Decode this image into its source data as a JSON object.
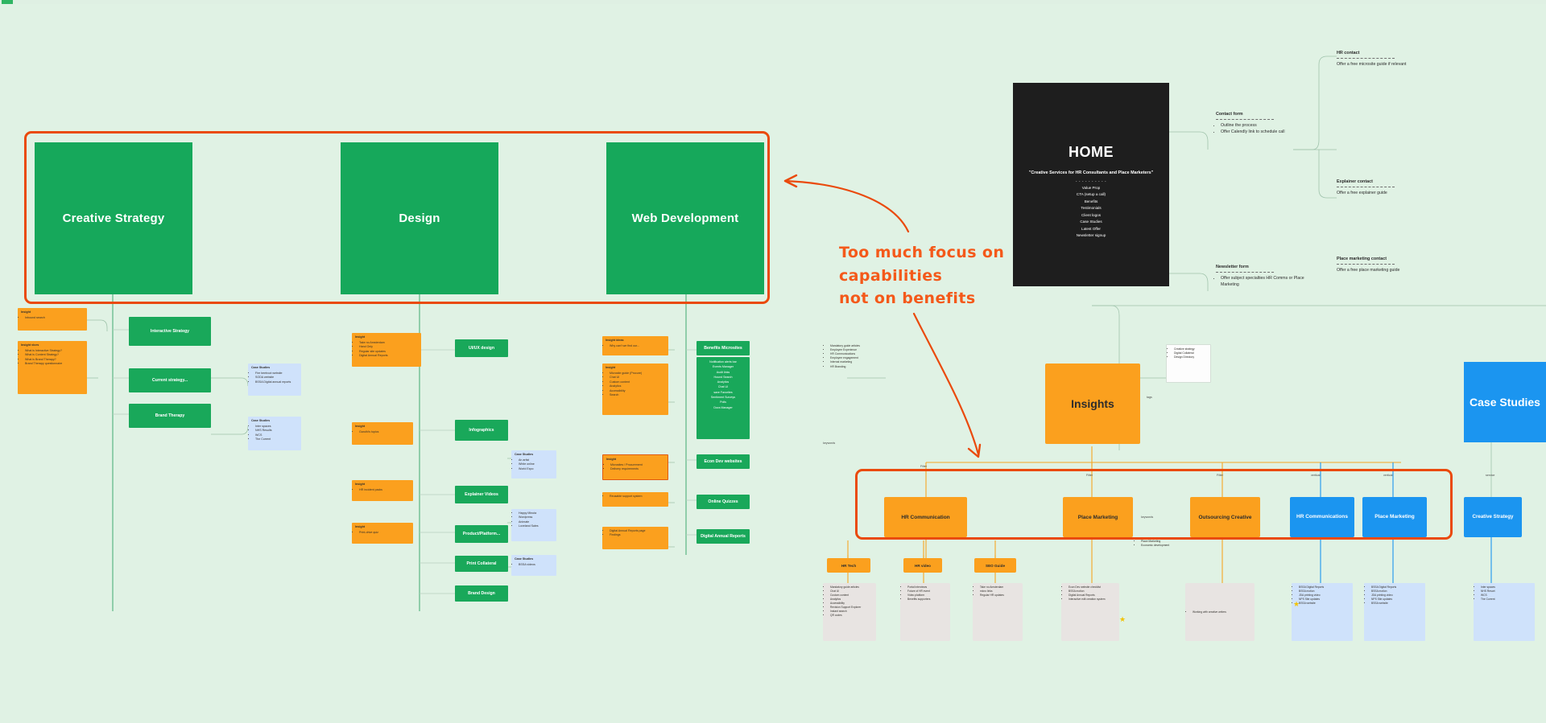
{
  "meta": {
    "title": "Website sitemap / user-flow whiteboard",
    "canvas_bg": "#e0f2e4",
    "accent_orange": "#ea4a0c",
    "green": "#19a85a",
    "amber": "#fba01e",
    "blue": "#1b95f0"
  },
  "annotation": {
    "text": "Too much focus on\ncapabilities\nnot on benefits",
    "color": "#f4591a"
  },
  "pillars": [
    {
      "label": "Creative Strategy"
    },
    {
      "label": "Design"
    },
    {
      "label": "Web Development"
    }
  ],
  "home": {
    "title": "HOME",
    "tagline": "\"Creative Services for HR Consultants and Place Marketers\"",
    "divider": "- - - - - - - - - -",
    "items": [
      "Value Prop",
      "CTA (setup a call)",
      "Benefits",
      "Testimonials",
      "Client logos",
      "Case Studies",
      "Latest Offer",
      "Newsletter signup"
    ]
  },
  "contact_flow": {
    "contact_form": {
      "title": "Contact form",
      "items": [
        "Outline the process",
        "Offer Calendly link to schedule call"
      ]
    },
    "newsletter_form": {
      "title": "Newsletter form",
      "items": [
        "Offer subject specialties HR Comms or Place Marketing"
      ]
    },
    "outcomes": [
      {
        "title": "HR contact",
        "body": "Offer a free microsite guide if relevant"
      },
      {
        "title": "Place marketing contact",
        "body": "Offer a free place marketing guide"
      },
      {
        "title": "Explainer contact",
        "body": "Offer a free explainer guide"
      }
    ]
  },
  "strategy_branch": {
    "nodes": [
      "Interactive Strategy",
      "Current strategy...",
      "Brand Therapy"
    ],
    "insights": [
      {
        "title": "Insight",
        "items": [
          "Inbound search"
        ]
      },
      {
        "title": "Insight vices",
        "items": [
          "What is Interactive Strategy?",
          "What is Content Strategy?",
          "What is Brand Therapy?",
          "Brand Therapy questionnaire"
        ]
      }
    ],
    "case_studies": [
      {
        "title": "Case Studies",
        "items": [
          "Fire beetroot website",
          "SODA website",
          "BSSA Digital annual reports"
        ]
      },
      {
        "title": "Case Studies",
        "items": [
          "Inter spaces",
          "NHS Results",
          "WCS",
          "The Current"
        ]
      }
    ]
  },
  "design_branch": {
    "nodes": [
      "UI/UX design",
      "Infographics",
      "Explainer Videos",
      "Product/Platform...",
      "Print Collateral",
      "Brand Design"
    ],
    "insights": [
      {
        "title": "Insight",
        "items": [
          "Take no Amsterdam",
          "Hand Only",
          "Regular site updates",
          "Digital Annual Reports"
        ]
      },
      {
        "title": "Insight",
        "items": [
          "Gandhi's topics"
        ]
      },
      {
        "title": "Insight",
        "items": [
          "HR incident packs"
        ]
      },
      {
        "title": "Insight",
        "items": [
          "Print-drive quiz"
        ]
      }
    ],
    "case_studies": [
      {
        "title": "Case Studies",
        "items": [
          "An artist",
          "White online",
          "World Expo"
        ]
      },
      {
        "title": "Case Studies",
        "items": [
          "Happy Minuta",
          "Wordpress",
          "Animate",
          "Loveland Sales"
        ]
      },
      {
        "title": "Case Studies",
        "items": [
          "BSSA videos"
        ]
      }
    ]
  },
  "web_branch": {
    "nodes": [
      "Benefits Microsites",
      "Econ Dev websites",
      "Online Quizzes",
      "Digital Annual Reports"
    ],
    "microsite_features": [
      "Notification alerts bar",
      "Events Manager",
      "Audit links",
      "Hound Search",
      "Analytics",
      "Chat UI",
      "save Favorites",
      "Sentiment Surveys",
      "Polls",
      "Docs Manager"
    ],
    "insights": [
      {
        "title": "Insight ideas",
        "items": [
          "Why can't we find our..."
        ]
      },
      {
        "title": "Insight",
        "items": [
          "Microsite guide (Procure)",
          "Chat UI",
          "Custom content",
          "Analytics",
          "Accessibility",
          "Search"
        ]
      },
      {
        "title": "Insight",
        "items": [
          "Microsites / Procurement",
          "Delivery requirements"
        ]
      },
      {
        "title": "Insight",
        "items": [
          "Reusable support system"
        ]
      },
      {
        "title": "Insight",
        "items": [
          "Digital Annual Reports page",
          "Findings"
        ]
      }
    ]
  },
  "insights_hub": {
    "label": "Insights",
    "inputs_card": {
      "items": [
        "Mandatory guide articles",
        "Employee Experience",
        "HR Communications",
        "Employee engagement",
        "Internal marketing",
        "HR Branding"
      ]
    },
    "right_card": {
      "items": [
        "Creative strategy",
        "Digital Collateral",
        "Design Directory"
      ]
    },
    "edge_label_left": "keywords",
    "edge_label_right": "tags"
  },
  "case_studies_hub": {
    "label": "Case Studies"
  },
  "audience_row": {
    "highlighted": true,
    "items": [
      {
        "label": "HR Communication",
        "color": "amber",
        "edge": "Filter"
      },
      {
        "label": "Place Marketing",
        "color": "amber",
        "edge": "Filter"
      },
      {
        "label": "Outsourcing Creative",
        "color": "amber",
        "edge": "Filter"
      },
      {
        "label": "HR Communications",
        "color": "blue",
        "edge": "vertical"
      },
      {
        "label": "Place Marketing",
        "color": "blue",
        "edge": "vertical"
      },
      {
        "label": "Creative Strategy",
        "color": "blue",
        "edge": "service"
      }
    ],
    "mid_label": "keywords",
    "sub_note": [
      "Place Marketing",
      "Economic development"
    ]
  },
  "tag_row": [
    {
      "label": "HR Tech"
    },
    {
      "label": "HR video"
    },
    {
      "label": "SEO Guide"
    }
  ],
  "bottom_cards": [
    {
      "items": [
        "Mandatory guide articles",
        "Chat UI",
        "Custom content",
        "Analytics",
        "Accessibility",
        "Revision Support Explorer",
        "Instant search",
        "QR codes"
      ]
    },
    {
      "items": [
        "Portal interviews",
        "Future of HR event",
        "Video platform",
        "Benefits supporters"
      ]
    },
    {
      "items": [
        "Take no Amsterdam",
        "micro links",
        "Regular HR updates"
      ]
    },
    {
      "items": [
        "Econ Dev website checklist",
        "BSSA motion",
        "Digital Annual Reports",
        "Interactive edit creation system"
      ]
    },
    {
      "items": [
        "Working with creative writers"
      ]
    },
    {
      "items": [
        "BSSA Digital Reports",
        "BSSA motion",
        "JDA printing video",
        "NPS Site updates",
        "BSSA website"
      ]
    },
    {
      "items": [
        "Inter spaces",
        "NHS Resort",
        "WCS",
        "The Current"
      ]
    }
  ]
}
